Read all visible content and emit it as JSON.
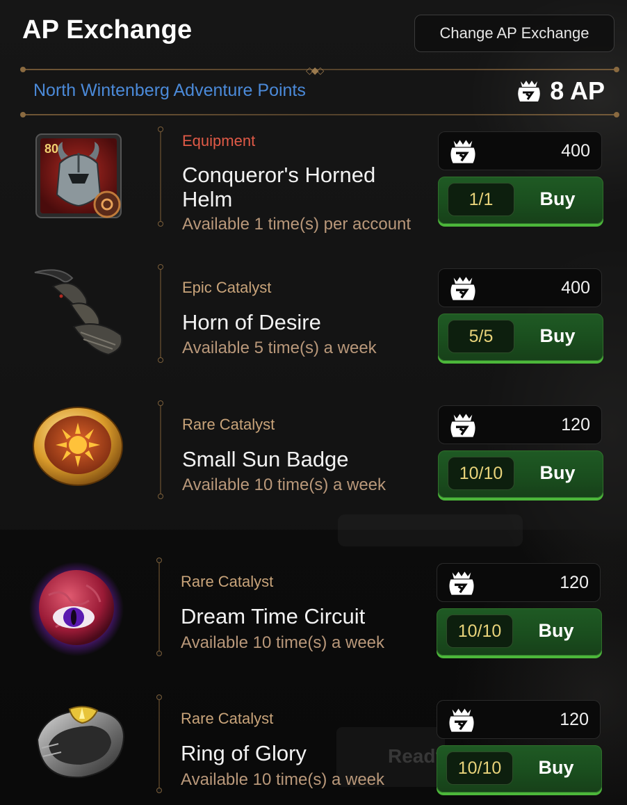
{
  "header": {
    "title": "AP Exchange",
    "change_button": "Change AP Exchange"
  },
  "region": {
    "name": "North Wintenberg Adventure Points",
    "ap_total": "8 AP",
    "currency_icon": "ap-pouch-icon"
  },
  "items": [
    {
      "category": "Equipment",
      "name_line1": "Conqueror's Horned",
      "name_line2": "Helm",
      "availability": "Available 1 time(s) per account",
      "price": "400",
      "stock": "1/1",
      "buy_label": "Buy",
      "level_badge": "80",
      "icon": "horned-helm-icon"
    },
    {
      "category": "Epic Catalyst",
      "name_line1": "Horn of Desire",
      "availability": "Available 5 time(s) a week",
      "price": "400",
      "stock": "5/5",
      "buy_label": "Buy",
      "icon": "horn-icon"
    },
    {
      "category": "Rare Catalyst",
      "name_line1": "Small Sun Badge",
      "availability": "Available 10 time(s) a week",
      "price": "120",
      "stock": "10/10",
      "buy_label": "Buy",
      "icon": "sun-badge-icon"
    },
    {
      "category": "Rare Catalyst",
      "name_line1": "Dream Time Circuit",
      "availability": "Available 10 time(s) a week",
      "price": "120",
      "stock": "10/10",
      "buy_label": "Buy",
      "icon": "eye-orb-icon"
    },
    {
      "category": "Rare Catalyst",
      "name_line1": "Ring of Glory",
      "availability": "Available 10 time(s) a week",
      "price": "120",
      "stock": "10/10",
      "buy_label": "Buy",
      "icon": "ring-icon"
    }
  ],
  "overlay": {
    "ghost_text": "Ready"
  },
  "colors": {
    "region_text": "#4b8ad9",
    "equipment_category": "#e05a47",
    "catalyst_category": "#c9a47a",
    "buy_button": "#1f5a24",
    "stock_text": "#e8d37a"
  }
}
